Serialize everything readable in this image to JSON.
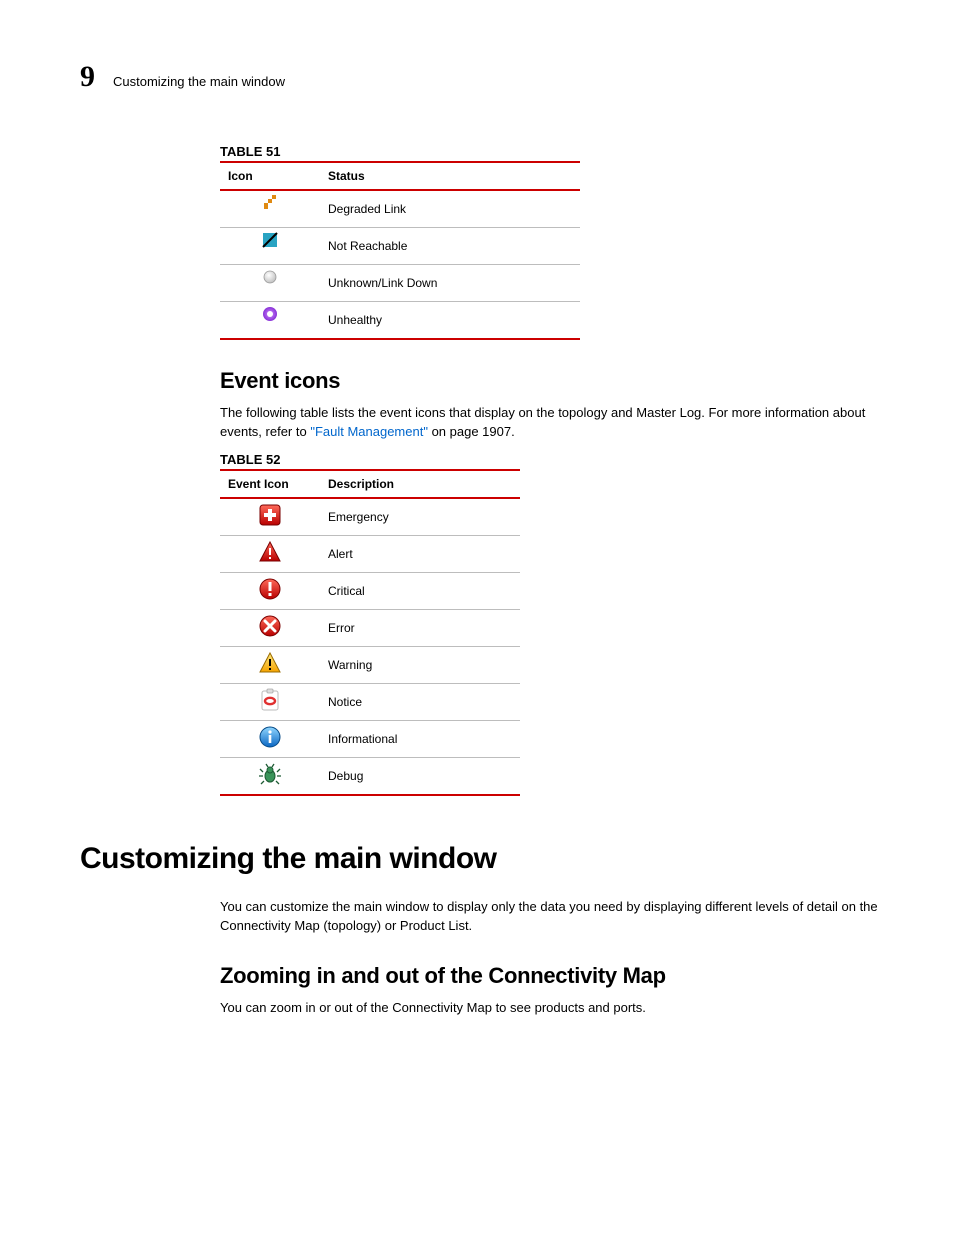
{
  "header": {
    "chapter_number": "9",
    "running_head": "Customizing the main window"
  },
  "table51": {
    "label": "TABLE 51",
    "headers": {
      "col1": "Icon",
      "col2": "Status"
    },
    "rows": [
      {
        "icon": "degraded-link-icon",
        "status": "Degraded Link"
      },
      {
        "icon": "not-reachable-icon",
        "status": "Not Reachable"
      },
      {
        "icon": "unknown-link-down-icon",
        "status": "Unknown/Link Down"
      },
      {
        "icon": "unhealthy-icon",
        "status": "Unhealthy"
      }
    ]
  },
  "section_event_icons": {
    "heading": "Event icons",
    "para_pre": "The following table lists the event icons that display on the topology and Master Log. For more information about events, refer to ",
    "link_text": "\"Fault Management\"",
    "para_post": " on page 1907."
  },
  "table52": {
    "label": "TABLE 52",
    "headers": {
      "col1": "Event Icon",
      "col2": "Description"
    },
    "rows": [
      {
        "icon": "emergency-icon",
        "desc": "Emergency"
      },
      {
        "icon": "alert-icon",
        "desc": "Alert"
      },
      {
        "icon": "critical-icon",
        "desc": "Critical"
      },
      {
        "icon": "error-icon",
        "desc": "Error"
      },
      {
        "icon": "warning-icon",
        "desc": "Warning"
      },
      {
        "icon": "notice-icon",
        "desc": "Notice"
      },
      {
        "icon": "informational-icon",
        "desc": "Informational"
      },
      {
        "icon": "debug-icon",
        "desc": "Debug"
      }
    ]
  },
  "section_customizing": {
    "heading": "Customizing the main window",
    "para": "You can customize the main window to display only the data you need by displaying different levels of detail on the Connectivity Map (topology) or Product List."
  },
  "section_zoom": {
    "heading": "Zooming in and out of the Connectivity Map",
    "para": "You can zoom in or out of the Connectivity Map to see products and ports."
  }
}
